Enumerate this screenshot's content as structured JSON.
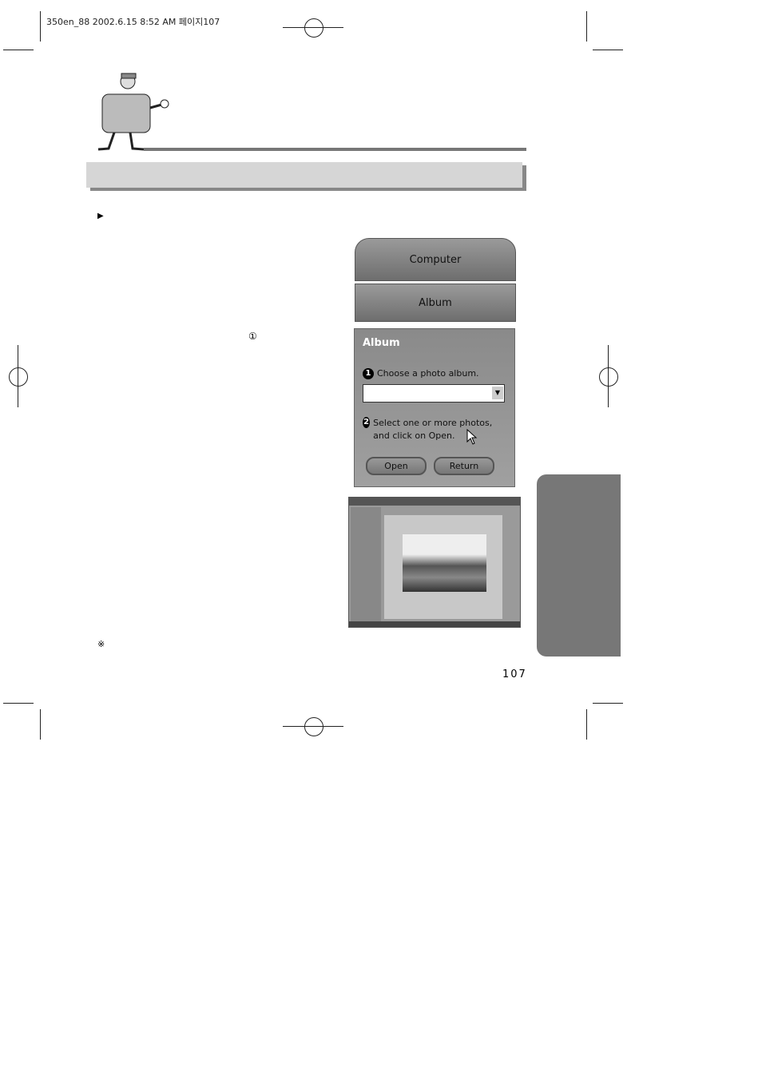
{
  "print_header": "350en_88  2002.6.15 8:52 AM 페이지107",
  "bullet_marker": "▶",
  "circled_marker": "①",
  "note_marker": "※",
  "app": {
    "tabs": [
      {
        "label": "Computer"
      },
      {
        "label": "Album"
      }
    ],
    "panel": {
      "title": "Album",
      "step1": {
        "num": "1",
        "text": "Choose a photo album."
      },
      "select_value": "",
      "step2": {
        "num": "2",
        "text": "Select one or more photos, and click on Open."
      },
      "buttons": {
        "open": "Open",
        "return": "Return"
      }
    }
  },
  "page_number": "107"
}
